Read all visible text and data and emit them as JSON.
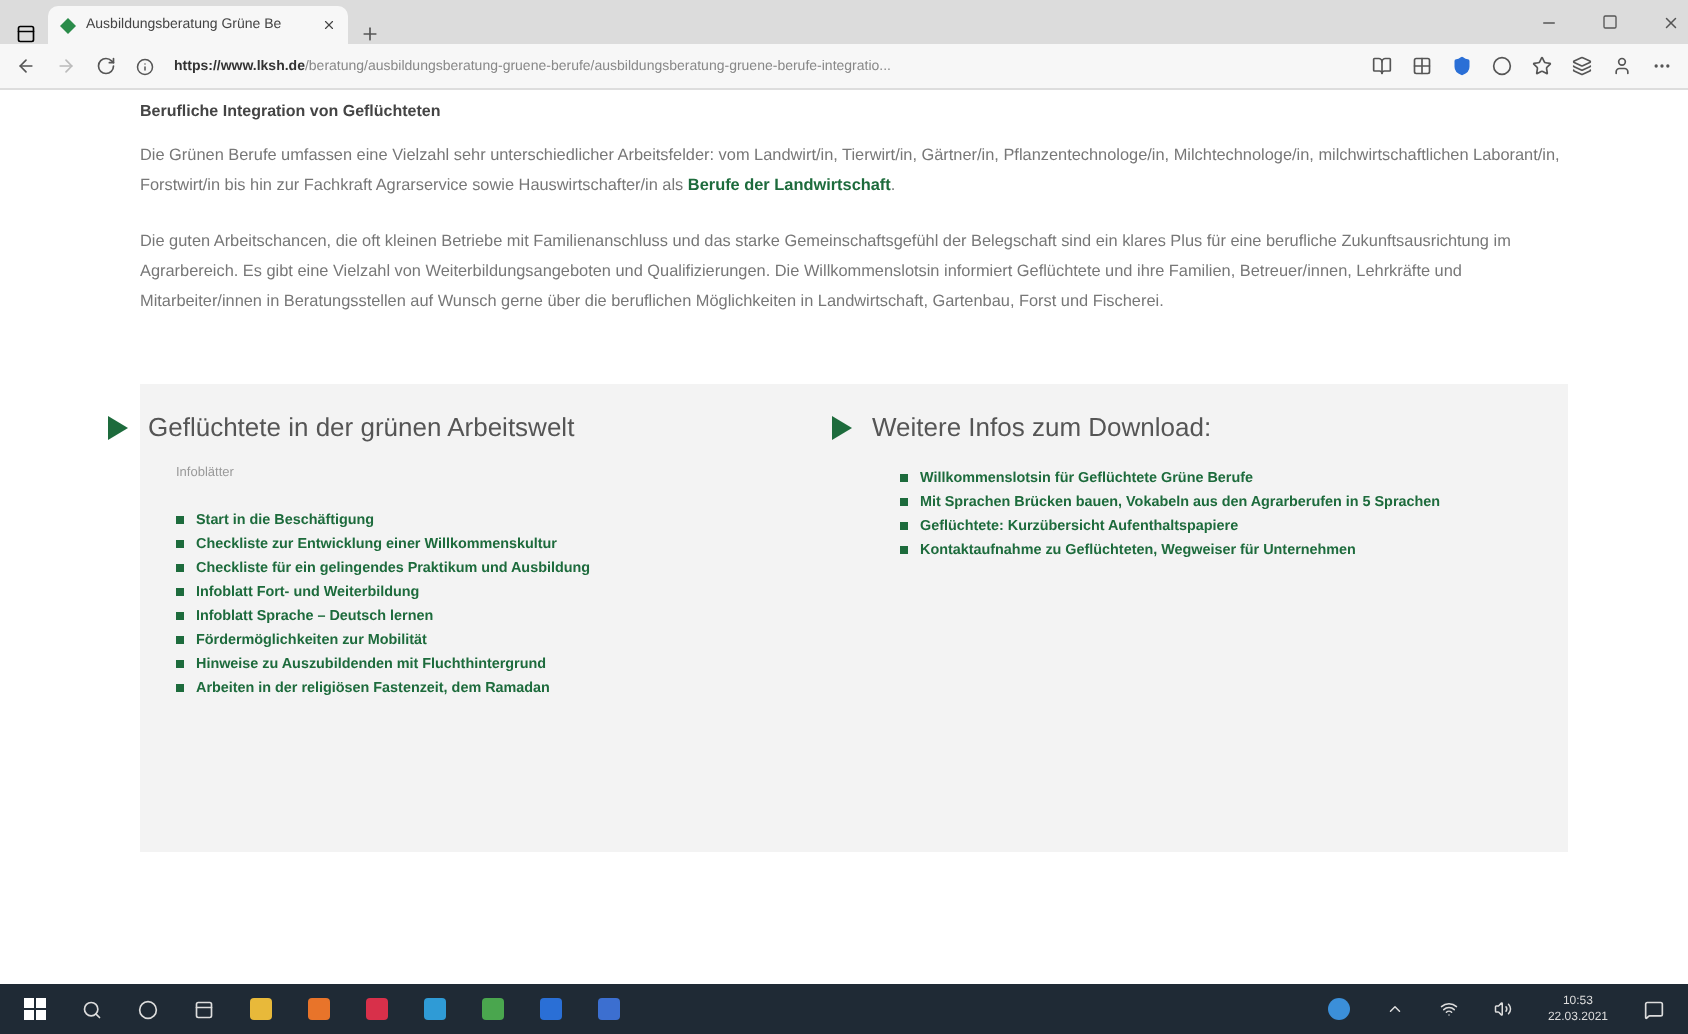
{
  "browser": {
    "tab": {
      "title": "Ausbildungsberatung Grüne Be",
      "selected": true
    },
    "address": {
      "host": "https://www.lksh.de",
      "path": "/beratung/ausbildungsberatung-gruene-berufe/ausbildungsberatung-gruene-berufe-integratio..."
    }
  },
  "article": {
    "heading": "Berufliche Integration von Geflüchteten",
    "paragraphs": [
      "Die Grünen Berufe umfassen eine Vielzahl sehr unterschiedlicher Arbeitsfelder: vom Landwirt/in, Tierwirt/in, Gärtner/in, Pflanzentechnologe/in, Milchtechnologe/in, milchwirtschaftlichen Laborant/in, Forstwirt/in bis hin zur Fachkraft Agrarservice sowie Hauswirtschafter/in als **Berufe der Landwirtschaft**.",
      "Die guten Arbeitschancen, die oft kleinen Betriebe mit Familienanschluss und das starke Gemeinschaftsgefühl der Belegschaft sind ein klares Plus für eine berufliche Zukunftsausrichtung im Agrarbereich. Es gibt eine Vielzahl von Weiterbildungsangeboten und Qualifizierungen. Die Willkommenslotsin informiert Geflüchtete und ihre Familien, Betreuer/innen, Lehrkräfte und Mitarbeiter/innen in Beratungsstellen auf Wunsch gerne über die beruflichen Möglichkeiten in Landwirtschaft, Gartenbau, Forst und Fischerei."
    ]
  },
  "columns": [
    {
      "title": "Geflüchtete in der grünen Arbeitswelt",
      "subtitle": "Infoblätter",
      "links": [
        "Start in die Beschäftigung",
        "Checkliste zur Entwicklung einer Willkommenskultur",
        "Checkliste für ein gelingendes Praktikum und Ausbildung",
        "Infoblatt Fort- und Weiterbildung",
        "Infoblatt Sprache – Deutsch lernen",
        "Fördermöglichkeiten zur Mobilität",
        "Hinweise zu Auszubildenden mit Fluchthintergrund",
        "Arbeiten in der religiösen Fastenzeit, dem Ramadan"
      ]
    },
    {
      "title": "Weitere Infos zum Download:",
      "links": [
        "Willkommenslotsin für Geflüchtete Grüne Berufe",
        "Mit Sprachen Brücken bauen, Vokabeln aus den Agrarberufen in 5 Sprachen",
        "Geflüchtete: Kurzübersicht Aufenthaltspapiere",
        "Kontaktaufnahme zu Geflüchteten, Wegweiser für Unternehmen"
      ]
    }
  ],
  "taskbar": {
    "time": "10:53",
    "date": "22.03.2021"
  }
}
